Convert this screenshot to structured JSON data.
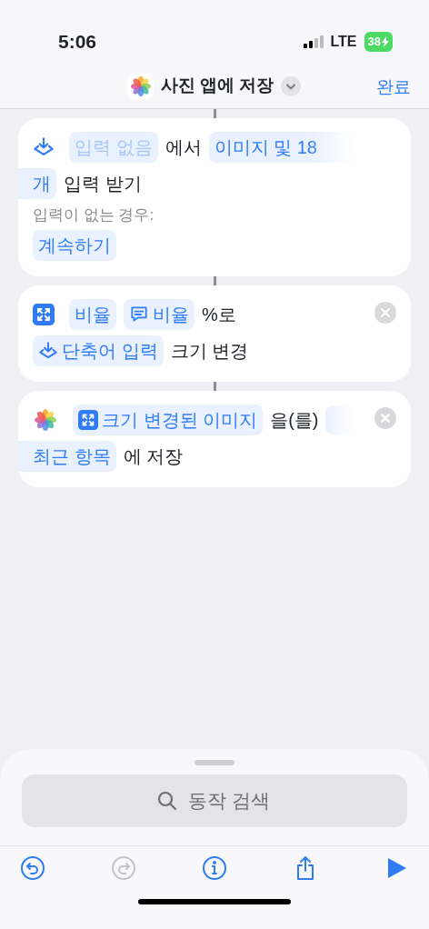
{
  "status_bar": {
    "time": "5:06",
    "network": "LTE",
    "battery": "38",
    "charging": true
  },
  "header": {
    "title": "사진 앱에 저장",
    "done": "완료"
  },
  "actions": [
    {
      "closable": false,
      "lines": [
        [
          {
            "kind": "token",
            "text": "입력 없음",
            "dim": true
          },
          {
            "kind": "text",
            "text": "에서"
          },
          {
            "kind": "token",
            "text": "이미지 및 18",
            "fade": true
          }
        ],
        [
          {
            "kind": "token",
            "text": "개",
            "bleed": true
          },
          {
            "kind": "text",
            "text": "입력 받기"
          }
        ]
      ],
      "note": "입력이 없는 경우:",
      "note_token": "계속하기"
    },
    {
      "closable": true,
      "lines": [
        [
          {
            "kind": "token",
            "text": "비율"
          },
          {
            "kind": "token",
            "text": "비율"
          },
          {
            "kind": "text",
            "text": "%로"
          }
        ],
        [
          {
            "kind": "token",
            "text": "단축어 입력"
          },
          {
            "kind": "text",
            "text": "크기 변경"
          }
        ]
      ]
    },
    {
      "closable": true,
      "lines": [
        [
          {
            "kind": "token",
            "text": "크기 변경된 이미지"
          },
          {
            "kind": "text",
            "text": "을(를)"
          },
          {
            "kind": "blank"
          }
        ],
        [
          {
            "kind": "token",
            "text": "최근 항목",
            "bleed": true
          },
          {
            "kind": "text",
            "text": "에 저장"
          }
        ]
      ]
    }
  ],
  "search": {
    "placeholder": "동작 검색"
  },
  "toolbar": [
    {
      "kind": "undo",
      "disabled": false
    },
    {
      "kind": "redo",
      "disabled": true
    },
    {
      "kind": "info",
      "disabled": false
    },
    {
      "kind": "share",
      "disabled": false
    },
    {
      "kind": "play",
      "disabled": false
    }
  ]
}
